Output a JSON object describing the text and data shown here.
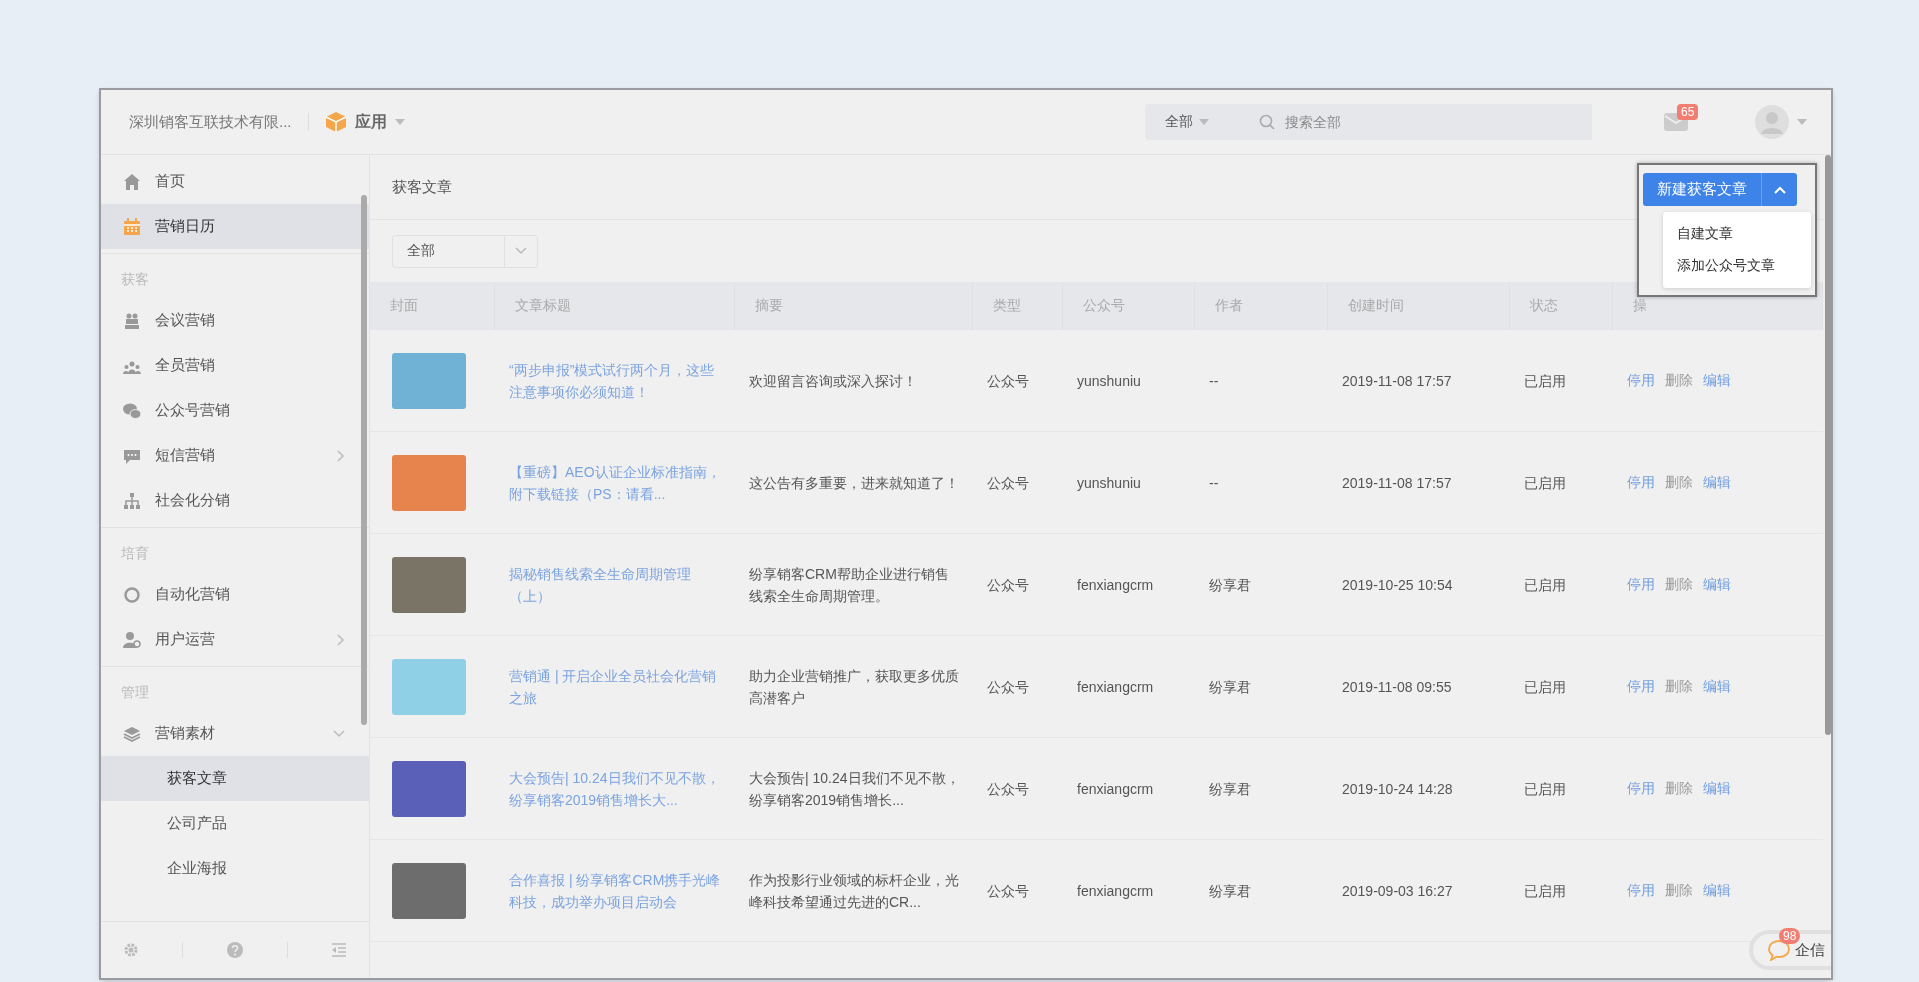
{
  "header": {
    "company": "深圳销客互联技术有限...",
    "app_menu": "应用",
    "search_scope": "全部",
    "search": {
      "placeholder": "搜索全部"
    },
    "mail_badge": "65"
  },
  "sidebar": {
    "sections": [
      {
        "items": [
          {
            "label": "首页",
            "selected": false
          },
          {
            "label": "营销日历",
            "selected": true
          }
        ]
      },
      {
        "heading": "获客",
        "items": [
          {
            "label": "会议营销",
            "selected": false
          },
          {
            "label": "全员营销",
            "selected": false
          },
          {
            "label": "公众号营销",
            "selected": false
          },
          {
            "label": "短信营销",
            "selected": false,
            "expanded": false
          },
          {
            "label": "社会化分销",
            "selected": false
          }
        ]
      },
      {
        "heading": "培育",
        "items": [
          {
            "label": "自动化营销",
            "selected": false
          },
          {
            "label": "用户运营",
            "selected": false,
            "expanded": false
          }
        ]
      },
      {
        "heading": "管理",
        "items": [
          {
            "label": "营销素材",
            "selected": false,
            "expanded": true,
            "children": [
              {
                "label": "获客文章",
                "selected": true
              },
              {
                "label": "公司产品",
                "selected": false
              },
              {
                "label": "企业海报",
                "selected": false
              }
            ]
          }
        ]
      }
    ]
  },
  "page": {
    "title": "获客文章",
    "new_button": {
      "label": "新建获客文章",
      "menu_open": true,
      "menu": [
        "自建文章",
        "添加公众号文章"
      ]
    },
    "filter": {
      "value": "全部"
    }
  },
  "table": {
    "columns": [
      "封面",
      "文章标题",
      "摘要",
      "类型",
      "公众号",
      "作者",
      "创建时间",
      "状态",
      "操"
    ],
    "rows": [
      {
        "title": "“两步申报”模式试行两个月，这些注意事项你必须知道！",
        "summary": "欢迎留言咨询或深入探讨！",
        "type": "公众号",
        "account": "yunshuniu",
        "author": "--",
        "created": "2019-11-08 17:57",
        "status": "已启用",
        "actions": [
          {
            "label": "停用",
            "disabled": false
          },
          {
            "label": "删除",
            "disabled": true
          },
          {
            "label": "编辑",
            "disabled": false
          }
        ]
      },
      {
        "title": "【重磅】AEO认证企业标准指南，附下载链接（PS：请看...",
        "summary": "这公告有多重要，进来就知道了！",
        "type": "公众号",
        "account": "yunshuniu",
        "author": "--",
        "created": "2019-11-08 17:57",
        "status": "已启用",
        "actions": [
          {
            "label": "停用",
            "disabled": false
          },
          {
            "label": "删除",
            "disabled": true
          },
          {
            "label": "编辑",
            "disabled": false
          }
        ]
      },
      {
        "title": "揭秘销售线索全生命周期管理（上）",
        "summary": "纷享销客CRM帮助企业进行销售线索全生命周期管理。",
        "type": "公众号",
        "account": "fenxiangcrm",
        "author": "纷享君",
        "created": "2019-10-25 10:54",
        "status": "已启用",
        "actions": [
          {
            "label": "停用",
            "disabled": false
          },
          {
            "label": "删除",
            "disabled": true
          },
          {
            "label": "编辑",
            "disabled": false
          }
        ]
      },
      {
        "title": "营销通 | 开启企业全员社会化营销之旅",
        "summary": "助力企业营销推广，获取更多优质高潜客户",
        "type": "公众号",
        "account": "fenxiangcrm",
        "author": "纷享君",
        "created": "2019-11-08 09:55",
        "status": "已启用",
        "actions": [
          {
            "label": "停用",
            "disabled": false
          },
          {
            "label": "删除",
            "disabled": true
          },
          {
            "label": "编辑",
            "disabled": false
          }
        ]
      },
      {
        "title": "大会预告| 10.24日我们不见不散，纷享销客2019销售增长大...",
        "summary": "大会预告| 10.24日我们不见不散，纷享销客2019销售增长...",
        "type": "公众号",
        "account": "fenxiangcrm",
        "author": "纷享君",
        "created": "2019-10-24 14:28",
        "status": "已启用",
        "actions": [
          {
            "label": "停用",
            "disabled": false
          },
          {
            "label": "删除",
            "disabled": true
          },
          {
            "label": "编辑",
            "disabled": false
          }
        ]
      },
      {
        "title": "合作喜报 | 纷享销客CRM携手光峰科技，成功举办项目启动会",
        "summary": "作为投影行业领域的标杆企业，光峰科技希望通过先进的CR...",
        "type": "公众号",
        "account": "fenxiangcrm",
        "author": "纷享君",
        "created": "2019-09-03 16:27",
        "status": "已启用",
        "actions": [
          {
            "label": "停用",
            "disabled": false
          },
          {
            "label": "删除",
            "disabled": true
          },
          {
            "label": "编辑",
            "disabled": false
          }
        ]
      }
    ]
  },
  "chat_widget": {
    "label": "企信",
    "badge": "98"
  }
}
